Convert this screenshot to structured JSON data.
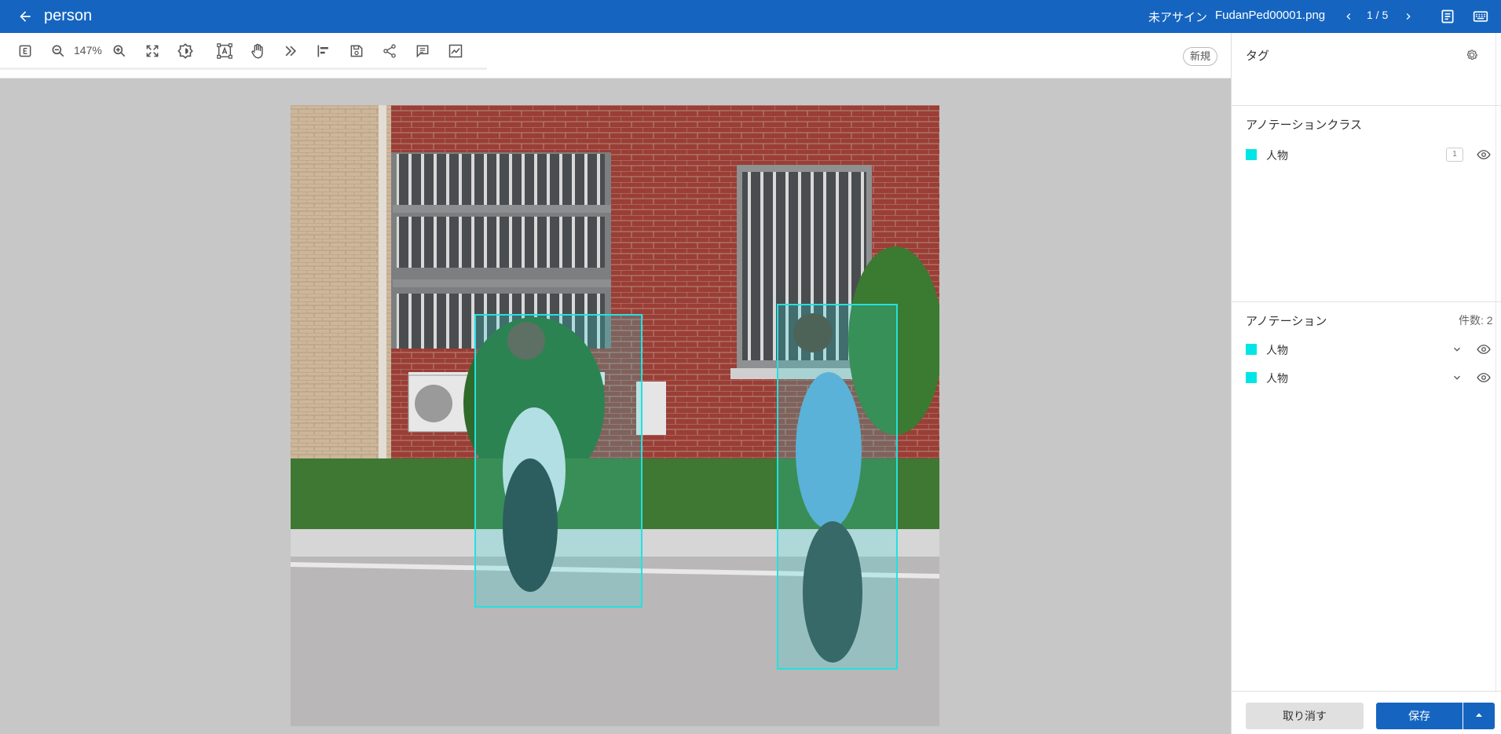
{
  "header": {
    "title": "person",
    "assignee_status": "未アサイン",
    "file_name": "FudanPed00001.png",
    "pager": "1 / 5"
  },
  "toolbar": {
    "zoom": "147%",
    "new_badge": "新規"
  },
  "icons": [
    "back-arrow-icon",
    "chevron-left-icon",
    "chevron-right-icon",
    "notes-icon",
    "keyboard-icon",
    "export-icon",
    "zoom-out-icon",
    "zoom-in-icon",
    "fit-screen-icon",
    "brightness-icon",
    "text-box-icon",
    "hand-icon",
    "double-chevron-icon",
    "align-left-icon",
    "save-disk-icon",
    "share-icon",
    "comment-icon",
    "chart-icon",
    "gear-icon",
    "eye-icon",
    "chevron-down-icon",
    "caret-up-icon"
  ],
  "sidebar": {
    "tags_title": "タグ",
    "classes_title": "アノテーションクラス",
    "classes": [
      {
        "label": "人物",
        "count": "1",
        "color": "#00e5e5"
      }
    ],
    "annotations_title": "アノテーション",
    "annotations_count": "件数: 2",
    "annotations": [
      {
        "label": "人物",
        "color": "#00e5e5"
      },
      {
        "label": "人物",
        "color": "#00e5e5"
      }
    ]
  },
  "footer": {
    "cancel_label": "取り消す",
    "save_label": "保存"
  },
  "colors": {
    "brand": "#1565c0",
    "annotation": "#00e5e5",
    "canvas_bg": "#c7c7c7"
  }
}
